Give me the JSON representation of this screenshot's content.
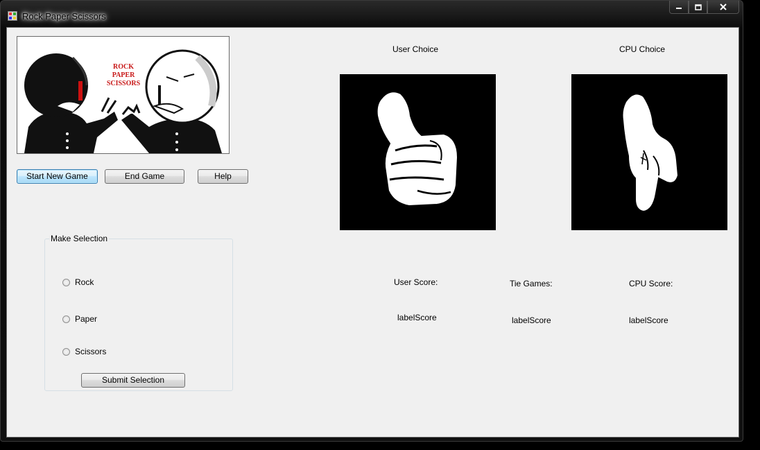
{
  "window": {
    "title": "Rock Paper Scissors"
  },
  "banner": {
    "text_lines": [
      "ROCK",
      "PAPER",
      "SCISSORS"
    ]
  },
  "buttons": {
    "start": "Start New Game",
    "end": "End Game",
    "help": "Help",
    "submit": "Submit Selection"
  },
  "selection": {
    "title": "Make Selection",
    "options": [
      "Rock",
      "Paper",
      "Scissors"
    ]
  },
  "choices": {
    "user_label": "User Choice",
    "cpu_label": "CPU Choice"
  },
  "scores": {
    "user_label": "User Score:",
    "tie_label": "Tie Games:",
    "cpu_label": "CPU Score:",
    "user_value": "labelScore",
    "tie_value": "labelScore",
    "cpu_value": "labelScore"
  },
  "icons": {
    "app": "app-icon",
    "minimize": "minimize-icon",
    "maximize": "maximize-icon",
    "close": "close-icon"
  }
}
